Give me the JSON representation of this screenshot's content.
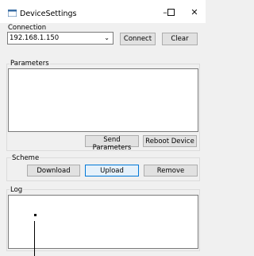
{
  "window": {
    "title": "DeviceSettings",
    "min": "–",
    "max": "☐",
    "close": "✕"
  },
  "connection": {
    "label": "Connection",
    "address": "192.168.1.150",
    "connect_label": "Connect",
    "clear_label": "Clear"
  },
  "parameters": {
    "label": "Parameters",
    "content": "",
    "send_label": "Send Parameters",
    "reboot_label": "Reboot Device"
  },
  "scheme": {
    "label": "Scheme",
    "download_label": "Download",
    "upload_label": "Upload",
    "remove_label": "Remove"
  },
  "log": {
    "label": "Log",
    "content": ""
  },
  "colors": {
    "accent": "#0078d7",
    "window_bg": "#f0f0f0"
  }
}
